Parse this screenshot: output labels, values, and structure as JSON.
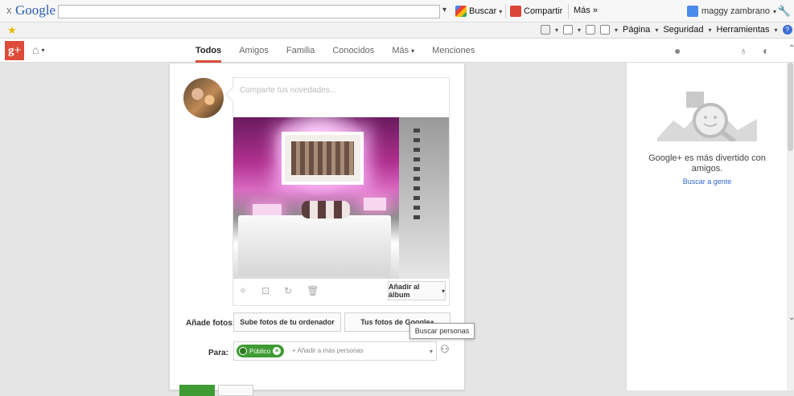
{
  "toolbar": {
    "close": "x",
    "logo": "Google",
    "search_value": "",
    "buscar_label": "Buscar",
    "compartir_label": "Compartir",
    "mas_label": "Más »",
    "user_name": "maggy zambrano"
  },
  "iebar": {
    "pagina": "Página",
    "seguridad": "Seguridad",
    "herramientas": "Herramientas"
  },
  "gplus": {
    "logo": "g+",
    "tabs": [
      "Todos",
      "Amigos",
      "Familia",
      "Conocidos",
      "Más",
      "Menciones"
    ],
    "active_tab": "Todos"
  },
  "post": {
    "placeholder": "Comparte tus novedades...",
    "add_album": "Añadir al álbum",
    "add_photos_label": "Añade fotos:",
    "upload_button": "Sube fotos de tu ordenador",
    "gphotos_button": "Tus fotos de Google+",
    "tooltip": "Buscar personas",
    "to_label": "Para:",
    "public_chip": "Público",
    "add_people": "+ Añadir a más personas"
  },
  "right_panel": {
    "message": "Google+ es más divertido con amigos.",
    "link": "Buscar a gente"
  },
  "colors": {
    "gplus_red": "#dd4b39",
    "public_green": "#3f9b33",
    "link_blue": "#3366cc"
  }
}
